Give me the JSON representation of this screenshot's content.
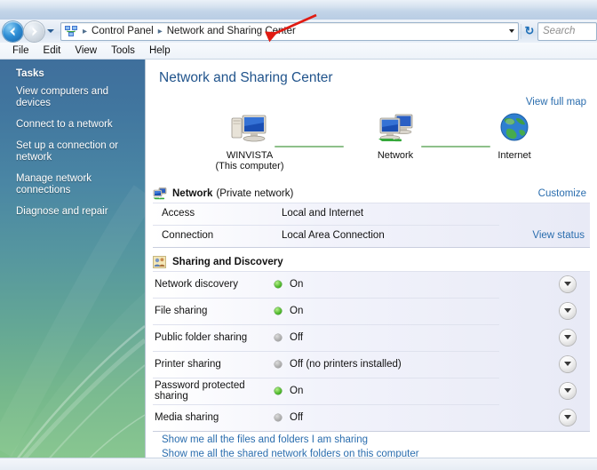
{
  "window": {
    "title": "Network and Sharing Center"
  },
  "addressbar": {
    "back_icon": "back-arrow-icon",
    "forward_icon": "forward-arrow-icon",
    "history_caret_icon": "chevron-down-icon",
    "location_icon": "network-icon",
    "crumbs": [
      "Control Panel",
      "Network and Sharing Center"
    ],
    "separator": "▸",
    "dropdown_icon": "chevron-down-icon",
    "refresh_icon": "refresh-icon",
    "refresh_glyph": "↻",
    "search_placeholder": "Search"
  },
  "menubar": {
    "items": [
      "File",
      "Edit",
      "View",
      "Tools",
      "Help"
    ]
  },
  "sidebar": {
    "heading": "Tasks",
    "items": [
      "View computers and devices",
      "Connect to a network",
      "Set up a connection or network",
      "Manage network connections",
      "Diagnose and repair"
    ]
  },
  "main": {
    "page_title": "Network and Sharing Center",
    "view_full_map": "View full map",
    "map": {
      "nodes": [
        {
          "icon": "computer-icon",
          "label": "WINVISTA",
          "sub": "(This computer)"
        },
        {
          "icon": "network-icon",
          "label": "Network",
          "sub": ""
        },
        {
          "icon": "globe-icon",
          "label": "Internet",
          "sub": ""
        }
      ]
    },
    "network_section": {
      "icon": "network-icon",
      "name": "Network",
      "type": "(Private network)",
      "customize": "Customize",
      "rows": [
        {
          "key": "Access",
          "value": "Local and Internet",
          "action": ""
        },
        {
          "key": "Connection",
          "value": "Local Area Connection",
          "action": "View status"
        }
      ]
    },
    "sharing_section": {
      "icon": "sharing-people-icon",
      "title": "Sharing and Discovery",
      "rows": [
        {
          "name": "Network discovery",
          "state": "On",
          "on": true
        },
        {
          "name": "File sharing",
          "state": "On",
          "on": true
        },
        {
          "name": "Public folder sharing",
          "state": "Off",
          "on": false
        },
        {
          "name": "Printer sharing",
          "state": "Off (no printers installed)",
          "on": false
        },
        {
          "name": "Password protected sharing",
          "state": "On",
          "on": true
        },
        {
          "name": "Media sharing",
          "state": "Off",
          "on": false
        }
      ],
      "expand_icon": "chevron-down-icon"
    },
    "bottom_links": [
      "Show me all the files and folders I am sharing",
      "Show me all the shared network folders on this computer"
    ]
  },
  "annotation": {
    "arrow_color": "#e01b12",
    "points_to": "Network and Sharing Center"
  },
  "colors": {
    "link": "#2a6dae",
    "title": "#21548c",
    "status_on": "#3fae1e",
    "status_off": "#a6a6a6",
    "sidebar_top": "#3f6f9c",
    "sidebar_bottom": "#86c78a"
  }
}
